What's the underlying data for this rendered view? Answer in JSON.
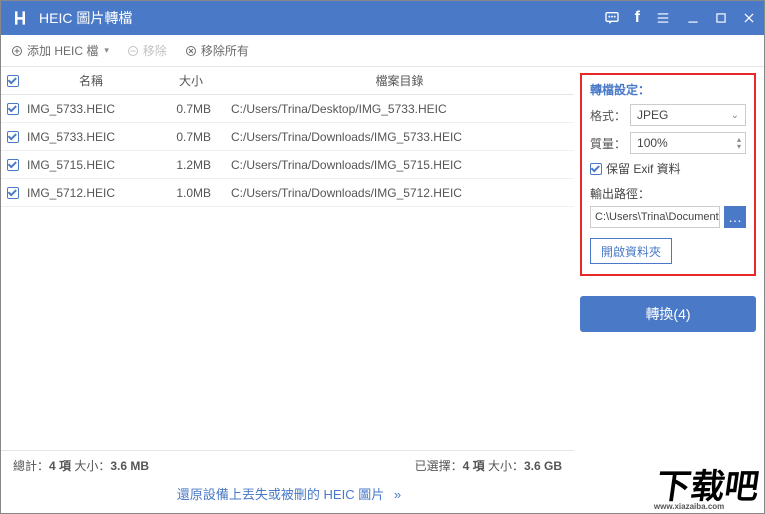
{
  "titlebar": {
    "title": "HEIC 圖片轉檔"
  },
  "toolbar": {
    "add_label": "添加 HEIC 檔",
    "remove_label": "移除",
    "remove_all_label": "移除所有"
  },
  "table": {
    "headers": {
      "name": "名稱",
      "size": "大小",
      "path": "檔案目錄"
    },
    "rows": [
      {
        "checked": true,
        "name": "IMG_5733.HEIC",
        "size": "0.7MB",
        "path": "C:/Users/Trina/Desktop/IMG_5733.HEIC"
      },
      {
        "checked": true,
        "name": "IMG_5733.HEIC",
        "size": "0.7MB",
        "path": "C:/Users/Trina/Downloads/IMG_5733.HEIC"
      },
      {
        "checked": true,
        "name": "IMG_5715.HEIC",
        "size": "1.2MB",
        "path": "C:/Users/Trina/Downloads/IMG_5715.HEIC"
      },
      {
        "checked": true,
        "name": "IMG_5712.HEIC",
        "size": "1.0MB",
        "path": "C:/Users/Trina/Downloads/IMG_5712.HEIC"
      }
    ]
  },
  "settings": {
    "title": "轉檔設定：",
    "format_label": "格式：",
    "format_value": "JPEG",
    "quality_label": "質量：",
    "quality_value": "100%",
    "exif_checked": true,
    "exif_label": "保留 Exif 資料",
    "output_label": "輸出路徑：",
    "output_path": "C:\\Users\\Trina\\Documents\\",
    "browse_label": "…",
    "open_folder_label": "開啟資料夾"
  },
  "convert": {
    "label": "轉換(4)"
  },
  "status": {
    "total_prefix": "總計：",
    "total_items": "4 項",
    "total_size_label": " 大小：",
    "total_size": "3.6 MB",
    "selected_prefix": "已選擇：",
    "selected_items": "4 項",
    "selected_size_label": " 大小：",
    "selected_size": "3.6 GB"
  },
  "recover": {
    "label": "還原設備上丟失或被刪的 HEIC 圖片"
  },
  "watermark": {
    "text": "下载吧",
    "url": "www.xiazaiba.com"
  }
}
